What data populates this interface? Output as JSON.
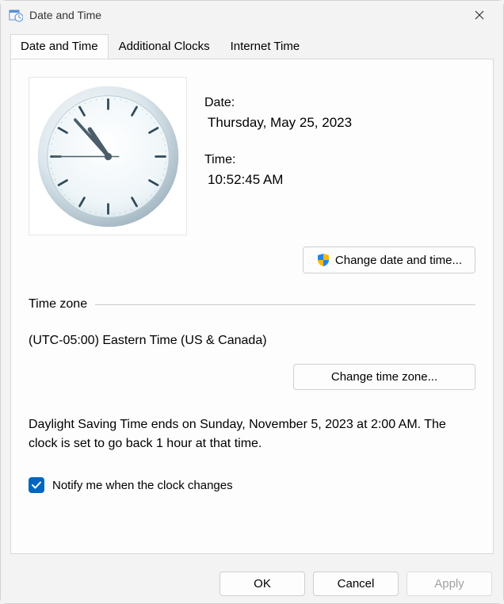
{
  "window": {
    "title": "Date and Time"
  },
  "tabs": {
    "items": [
      {
        "label": "Date and Time",
        "active": true
      },
      {
        "label": "Additional Clocks",
        "active": false
      },
      {
        "label": "Internet Time",
        "active": false
      }
    ]
  },
  "datetime": {
    "date_label": "Date:",
    "date_value": "Thursday, May 25, 2023",
    "time_label": "Time:",
    "time_value": "10:52:45 AM",
    "change_button": "Change date and time..."
  },
  "timezone": {
    "section_label": "Time zone",
    "value": "(UTC-05:00) Eastern Time (US & Canada)",
    "change_button": "Change time zone..."
  },
  "dst": {
    "text": "Daylight Saving Time ends on Sunday, November 5, 2023 at 2:00 AM. The clock is set to go back 1 hour at that time."
  },
  "notify": {
    "checked": true,
    "label": "Notify me when the clock changes"
  },
  "footer": {
    "ok": "OK",
    "cancel": "Cancel",
    "apply": "Apply"
  }
}
